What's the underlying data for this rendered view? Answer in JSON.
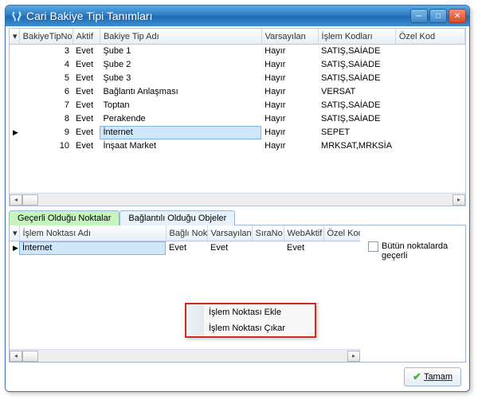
{
  "window": {
    "title": "Cari Bakiye Tipi Tanımları"
  },
  "titlebar_buttons": {
    "minimize": "─",
    "maximize": "□",
    "close": "✕"
  },
  "topgrid": {
    "columns": {
      "no": "BakiyeTipNo",
      "aktif": "Aktif",
      "ad": "Bakiye Tip Adı",
      "varsayilan": "Varsayılan",
      "islemkod": "İşlem Kodları",
      "ozelkod": "Özel Kod"
    },
    "rows": [
      {
        "no": "3",
        "aktif": "Evet",
        "ad": "Şube 1",
        "vars": "Hayır",
        "kod": "SATIŞ,SAİADE",
        "ozel": ""
      },
      {
        "no": "4",
        "aktif": "Evet",
        "ad": "Şube 2",
        "vars": "Hayır",
        "kod": "SATIŞ,SAİADE",
        "ozel": ""
      },
      {
        "no": "5",
        "aktif": "Evet",
        "ad": "Şube 3",
        "vars": "Hayır",
        "kod": "SATIŞ,SAİADE",
        "ozel": ""
      },
      {
        "no": "6",
        "aktif": "Evet",
        "ad": "Bağlantı Anlaşması",
        "vars": "Hayır",
        "kod": "VERSAT",
        "ozel": ""
      },
      {
        "no": "7",
        "aktif": "Evet",
        "ad": "Toptan",
        "vars": "Hayır",
        "kod": "SATIŞ,SAİADE",
        "ozel": ""
      },
      {
        "no": "8",
        "aktif": "Evet",
        "ad": "Perakende",
        "vars": "Hayır",
        "kod": "SATIŞ,SAİADE",
        "ozel": ""
      },
      {
        "no": "9",
        "aktif": "Evet",
        "ad": "İnternet",
        "vars": "Hayır",
        "kod": "SEPET",
        "ozel": ""
      },
      {
        "no": "10",
        "aktif": "Evet",
        "ad": "İnşaat Market",
        "vars": "Hayır",
        "kod": "MRKSAT,MRKSİA",
        "ozel": ""
      }
    ],
    "selected_row_index": 6,
    "selected_col": "ad"
  },
  "tabs": {
    "active": "Geçerli Olduğu Noktalar",
    "inactive": "Bağlantılı Olduğu Objeler"
  },
  "bottomgrid": {
    "columns": {
      "ad": "İşlem Noktası Adı",
      "bagli": "Bağlı Nok",
      "vars": "Varsayılan",
      "sira": "SıraNo",
      "web": "WebAktif",
      "ozel": "Özel Kod"
    },
    "rows": [
      {
        "ad": "İnternet",
        "bagli": "Evet",
        "vars": "Evet",
        "sira": "",
        "web": "Evet",
        "ozel": ""
      }
    ]
  },
  "right": {
    "alltext": "Bütün noktalarda geçerli"
  },
  "context_menu": {
    "item1": "İşlem Noktası Ekle",
    "item2": "İşlem Noktası Çıkar"
  },
  "footer": {
    "ok": "Tamam"
  }
}
